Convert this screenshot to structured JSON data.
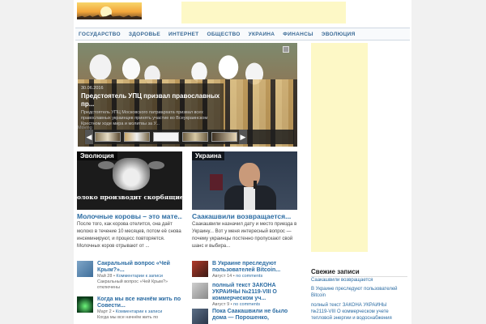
{
  "nav": {
    "items": [
      "ГОСУДАРСТВО",
      "ЗДОРОВЬЕ",
      "ИНТЕРНЕТ",
      "ОБЩЕСТВО",
      "УКРАИНА",
      "ФИНАНСЫ",
      "ЭВОЛЮЦИЯ"
    ]
  },
  "slider": {
    "date": "30.06.2016",
    "title": "Предстоятель УПЦ призвал православных пр...",
    "excerpt": "Предстоятель УПЦ Московского патриархата призвал всех православных украинцев принять участие во Всеукраинском Крестном ходе мира и молитвы за У...",
    "label": "Moving",
    "prev_icon": "chevron-left-icon",
    "next_icon": "chevron-right-icon"
  },
  "col1": {
    "category": "Эволюция",
    "image_text": "олоко производит скорбящие мате",
    "title": "Молочные коровы – это мате...",
    "excerpt": "После того, как корова отелится, она даёт молоко в течение 10 месяцев, потом её снова инсеминируют, и процесс повторяется. Молочных коров отрывают от ...",
    "items": [
      {
        "title": "Сакральный вопрос «Чей Крым?»...",
        "date": "Май 28",
        "comments": "Комментарии к записи",
        "extra": "Сакральный вопрос «Чей Крым?» отключены"
      },
      {
        "title": "Когда мы все начнём жить по Совести...",
        "date": "Март 2",
        "comments": "Комментарии к записи",
        "extra": "Когда мы все начнём жить по"
      }
    ]
  },
  "col2": {
    "category": "Украина",
    "title": "Саакашвили возвращается...",
    "excerpt": "Саакашвили назначил дату и место приезда в Украину... Вот у меня интересный вопрос — почему украинцы постенно пропускают свой шанс и выбира...",
    "items": [
      {
        "title": "В Украине преследуют пользователей Bitcoin...",
        "date": "Август 14",
        "comments": "no comments"
      },
      {
        "title": "полный текст ЗАКОНА УКРАИНЫ №2119-VIII О коммерческом уч...",
        "date": "Август 9",
        "comments": "no comments"
      },
      {
        "title": "Пока Саакашвили не было дома — Порошенко,"
      }
    ]
  },
  "sidebar": {
    "title": "Свежие записи",
    "links": [
      "Саакашвили возвращается",
      "В Украине преследуют пользователей Bitcoin",
      "полный текст ЗАКОНА УКРАИНЫ №2119-VIII О коммерческом учете тепловой энергии и водоснабжения"
    ]
  }
}
